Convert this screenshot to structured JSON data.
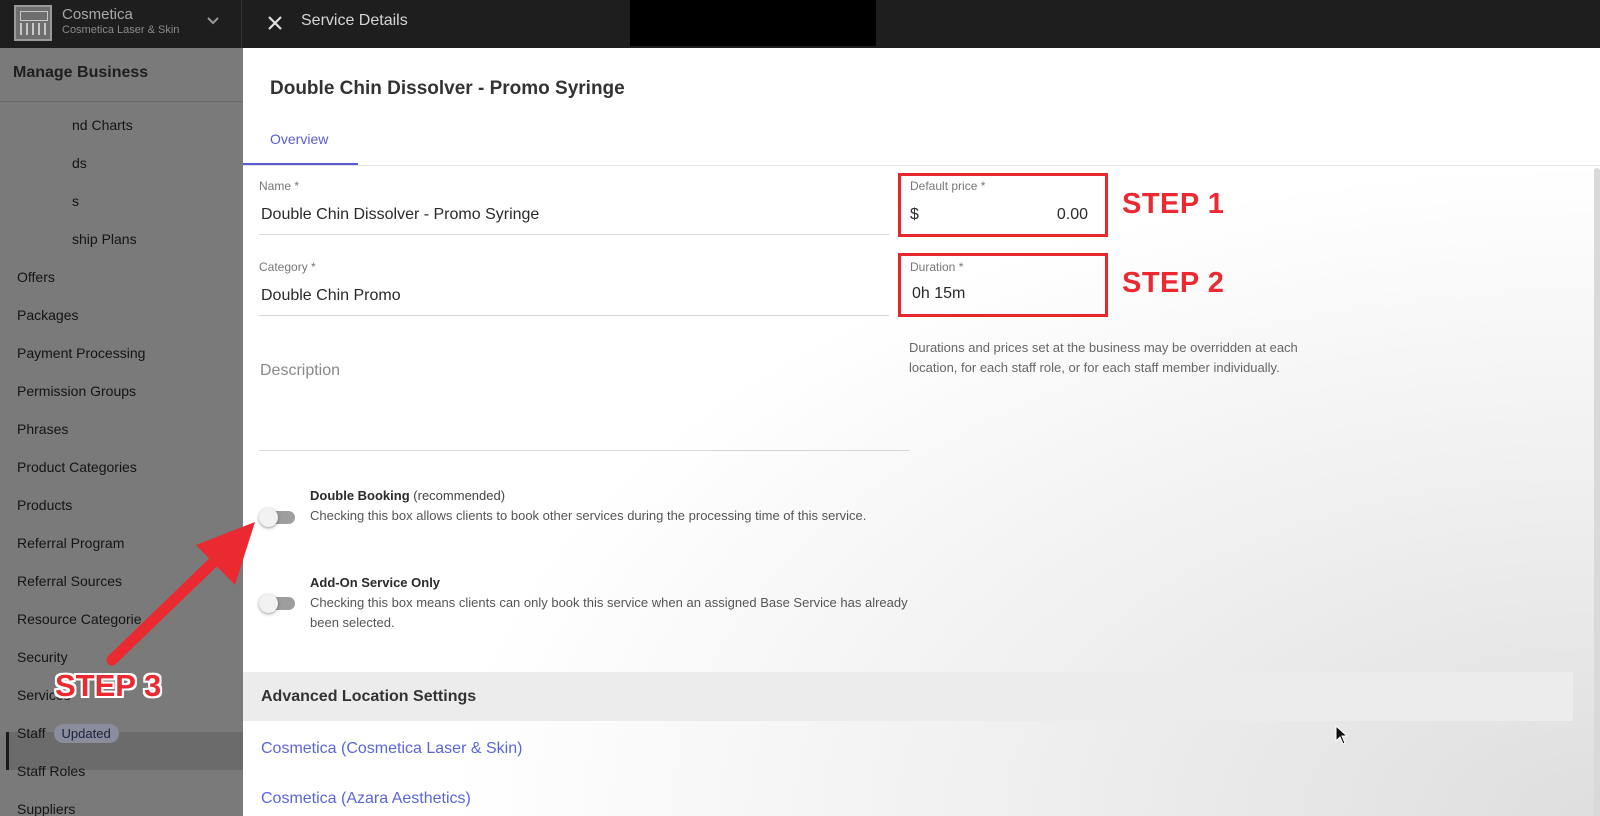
{
  "topbar": {
    "brand_name": "Cosmetica",
    "brand_sub": "Cosmetica Laser & Skin",
    "title": "Service Details"
  },
  "sidebar": {
    "header": "Manage Business",
    "items": [
      {
        "label": "nd Charts"
      },
      {
        "label": "ds"
      },
      {
        "label": "s"
      },
      {
        "label": "ship Plans"
      },
      {
        "label": "Offers"
      },
      {
        "label": "Packages"
      },
      {
        "label": "Payment Processing"
      },
      {
        "label": "Permission Groups"
      },
      {
        "label": "Phrases"
      },
      {
        "label": "Product Categories"
      },
      {
        "label": "Products"
      },
      {
        "label": "Referral Program"
      },
      {
        "label": "Referral Sources"
      },
      {
        "label": "Resource Categorie"
      },
      {
        "label": "Security"
      },
      {
        "label": "Services"
      },
      {
        "label": "Staff",
        "badge": "Updated"
      },
      {
        "label": "Staff Roles"
      },
      {
        "label": "Suppliers"
      }
    ]
  },
  "main": {
    "title": "Double Chin Dissolver - Promo Syringe",
    "tabs": [
      {
        "label": "Overview"
      }
    ],
    "name": {
      "label": "Name *",
      "value": "Double Chin Dissolver - Promo Syringe"
    },
    "category": {
      "label": "Category *",
      "value": "Double Chin Promo"
    },
    "description": {
      "label": "Description"
    },
    "default_price": {
      "label": "Default price *",
      "currency": "$",
      "value": "0.00"
    },
    "duration": {
      "label": "Duration *",
      "value": "0h 15m"
    },
    "help_text": "Durations and prices set at the business may be overridden at each location, for each staff role, or for each staff member individually.",
    "double_booking": {
      "title": "Double Booking",
      "note": "(recommended)",
      "description": "Checking this box allows clients to book other services during the processing time of this service.",
      "enabled": false
    },
    "add_on": {
      "title": "Add-On Service Only",
      "description": "Checking this box means clients can only book this service when an assigned Base Service has already been selected.",
      "enabled": false
    },
    "advanced": {
      "header": "Advanced Location Settings",
      "locations": [
        "Cosmetica (Cosmetica Laser & Skin)",
        "Cosmetica (Azara Aesthetics)"
      ]
    }
  },
  "annotations": {
    "step1": "STEP 1",
    "step2": "STEP 2",
    "step3": "STEP 3",
    "color": "#ea2a30"
  }
}
